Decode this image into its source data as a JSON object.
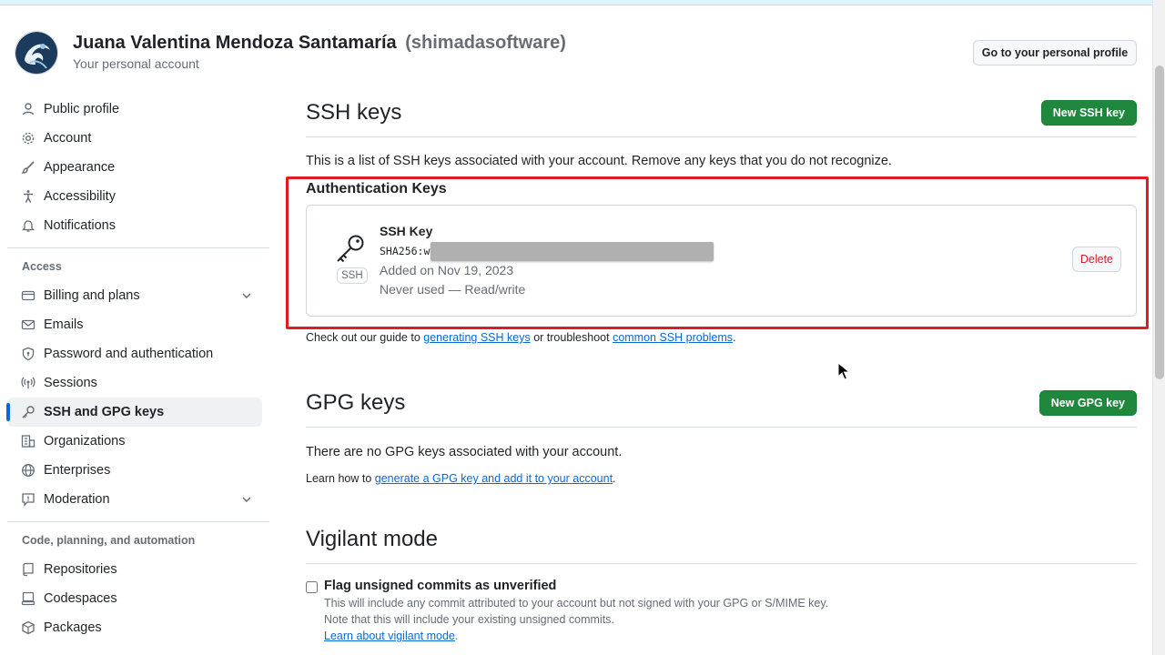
{
  "header": {
    "user_name": "Juana Valentina Mendoza Santamaría",
    "user_handle": "(shimadasoftware)",
    "subtitle": "Your personal account",
    "profile_button": "Go to your personal profile"
  },
  "sidebar": {
    "items": [
      {
        "label": "Public profile",
        "icon": "person-icon"
      },
      {
        "label": "Account",
        "icon": "gear-icon"
      },
      {
        "label": "Appearance",
        "icon": "paintbrush-icon"
      },
      {
        "label": "Accessibility",
        "icon": "accessibility-icon"
      },
      {
        "label": "Notifications",
        "icon": "bell-icon"
      }
    ],
    "access_heading": "Access",
    "access_items": [
      {
        "label": "Billing and plans",
        "icon": "credit-card-icon"
      },
      {
        "label": "Emails",
        "icon": "mail-icon"
      },
      {
        "label": "Password and authentication",
        "icon": "shield-lock-icon"
      },
      {
        "label": "Sessions",
        "icon": "broadcast-icon"
      },
      {
        "label": "SSH and GPG keys",
        "icon": "key-icon"
      },
      {
        "label": "Organizations",
        "icon": "organization-icon"
      },
      {
        "label": "Enterprises",
        "icon": "globe-icon"
      },
      {
        "label": "Moderation",
        "icon": "report-icon"
      }
    ],
    "code_heading": "Code, planning, and automation",
    "code_items": [
      {
        "label": "Repositories",
        "icon": "repo-icon"
      },
      {
        "label": "Codespaces",
        "icon": "codespaces-icon"
      },
      {
        "label": "Packages",
        "icon": "package-icon"
      }
    ]
  },
  "ssh": {
    "title": "SSH keys",
    "new_button": "New SSH key",
    "intro": "This is a list of SSH keys associated with your account. Remove any keys that you do not recognize.",
    "auth_heading": "Authentication Keys",
    "key": {
      "title": "SSH Key",
      "badge": "SSH",
      "fingerprint": "SHA256:w",
      "added": "Added on Nov 19, 2023",
      "usage": "Never used — Read/write",
      "delete_button": "Delete"
    },
    "guide_prefix": "Check out our guide to",
    "guide_link1": "generating SSH keys",
    "guide_middle": "or troubleshoot",
    "guide_link2": "common SSH problems",
    "guide_suffix": "."
  },
  "gpg": {
    "title": "GPG keys",
    "new_button": "New GPG key",
    "empty": "There are no GPG keys associated with your account.",
    "learn_prefix": "Learn how to",
    "learn_link": "generate a GPG key and add it to your account",
    "learn_suffix": "."
  },
  "vigilant": {
    "title": "Vigilant mode",
    "checkbox_label": "Flag unsigned commits as unverified",
    "note1": "This will include any commit attributed to your account but not signed with your GPG or S/MIME key.",
    "note2": "Note that this will include your existing unsigned commits.",
    "learn_link": "Learn about vigilant mode",
    "learn_suffix": "."
  },
  "colors": {
    "accent": "#0969da",
    "primary_button": "#1f883d",
    "danger": "#cf222e",
    "highlight": "#e01b24"
  }
}
